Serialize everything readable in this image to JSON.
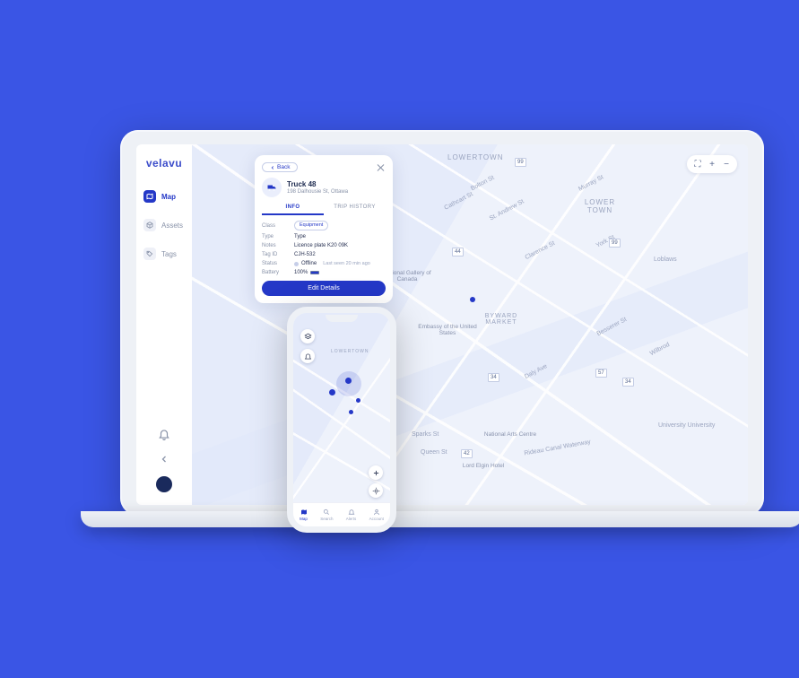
{
  "brand": {
    "name": "velavu"
  },
  "sidebar": {
    "items": [
      {
        "label": "Map",
        "icon": "map"
      },
      {
        "label": "Assets",
        "icon": "cube"
      },
      {
        "label": "Tags",
        "icon": "tag"
      }
    ]
  },
  "panel": {
    "back": "Back",
    "title": "Truck 48",
    "subtitle": "198 Dalhousie St, Ottawa",
    "tabs": {
      "info": "INFO",
      "trips": "TRIP HISTORY"
    },
    "fields": {
      "class_k": "Class",
      "class_v": "Equipment",
      "type_k": "Type",
      "type_v": "Type",
      "notes_k": "Notes",
      "notes_v": "Licence plate K20 09K",
      "tagid_k": "Tag ID",
      "tagid_v": "CJH-532",
      "status_k": "Status",
      "status_v": "Offline",
      "status_note": "Last seen 20 min ago",
      "battery_k": "Battery",
      "battery_v": "100%"
    },
    "cta": "Edit Details"
  },
  "mapLabels": {
    "lowertown_area": "LOWERTOWN",
    "lowertown_area2": "LOWER TOWN",
    "byward": "BYWARD MARKET",
    "bolton": "Bolton St",
    "cathcart": "Cathcart St",
    "standrew": "St. Andrew St",
    "murray": "Murray St",
    "clarence": "Clarence St",
    "york": "York St",
    "daly": "Daly Ave",
    "besserer": "Besserer St",
    "wilbrod": "Wilbrod",
    "sparks": "Sparks St",
    "queen": "Queen St",
    "loblaws": "Loblaws",
    "univ": "University University",
    "ng": "National Gallery of Canada",
    "embassy": "Embassy of the United States",
    "nac": "National Arts Centre",
    "lordelgin": "Lord Elgin Hotel",
    "rideau": "Rideau Canal Waterway",
    "r99": "99",
    "r44": "44",
    "r34": "34",
    "r42": "42",
    "r57": "57",
    "r99b": "99",
    "r34b": "34"
  },
  "mapTools": {
    "crosshair": "⛶",
    "plus": "+",
    "minus": "−"
  },
  "phone": {
    "tabs": [
      {
        "label": "Map"
      },
      {
        "label": "Search"
      },
      {
        "label": "Alerts"
      },
      {
        "label": "Account"
      }
    ],
    "area": "LOWERTOWN"
  }
}
